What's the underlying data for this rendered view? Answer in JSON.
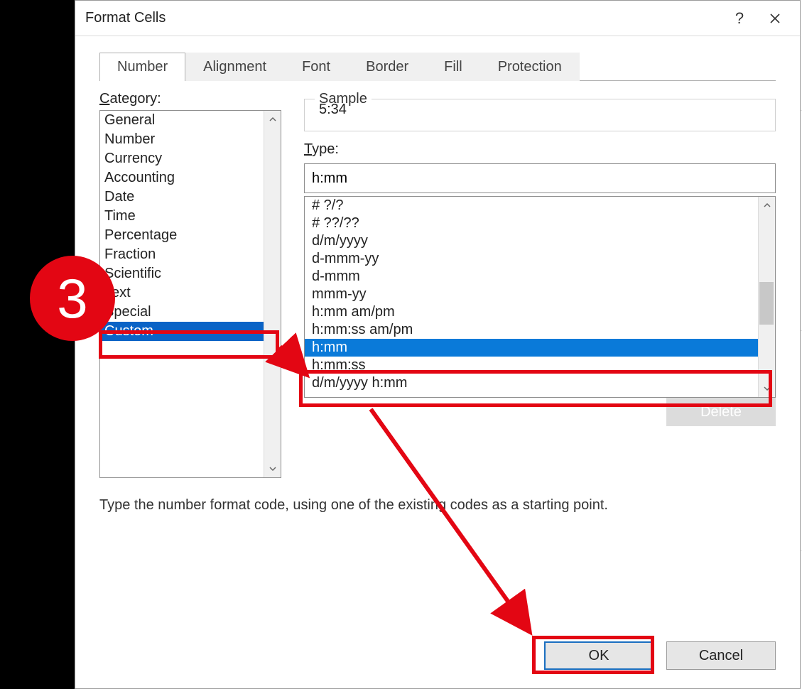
{
  "window": {
    "title": "Format Cells",
    "help_label": "?",
    "close_label": "✕"
  },
  "tabs": {
    "items": [
      "Number",
      "Alignment",
      "Font",
      "Border",
      "Fill",
      "Protection"
    ],
    "active_index": 0
  },
  "category": {
    "label": "Category:",
    "items": [
      "General",
      "Number",
      "Currency",
      "Accounting",
      "Date",
      "Time",
      "Percentage",
      "Fraction",
      "Scientific",
      "Text",
      "Special",
      "Custom"
    ],
    "selected_index": 11
  },
  "sample": {
    "legend": "Sample",
    "value": "5:34"
  },
  "type": {
    "label": "Type:",
    "input_value": "h:mm",
    "items": [
      "# ?/?",
      "# ??/??",
      "d/m/yyyy",
      "d-mmm-yy",
      "d-mmm",
      "mmm-yy",
      "h:mm am/pm",
      "h:mm:ss am/pm",
      "h:mm",
      "h:mm:ss",
      "d/m/yyyy h:mm"
    ],
    "selected_index": 8
  },
  "delete_label": "Delete",
  "help_text": "Type the number format code, using one of the existing codes as a starting point.",
  "buttons": {
    "ok": "OK",
    "cancel": "Cancel"
  },
  "annotation": {
    "step_number": "3"
  }
}
